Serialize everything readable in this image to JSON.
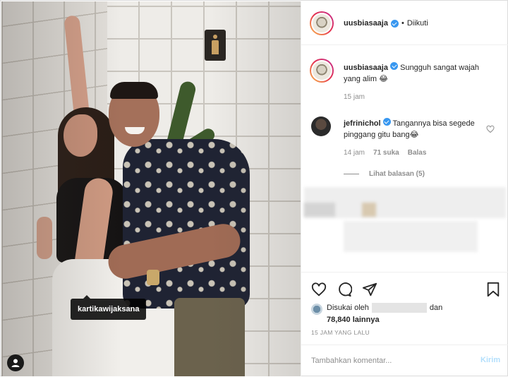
{
  "post": {
    "tagged_user": "kartikawijaksana"
  },
  "header": {
    "username": "uusbiasaaja",
    "separator": "•",
    "follow_status": "Diikuti"
  },
  "caption": {
    "username": "uusbiasaaja",
    "text": "Sungguh sangat wajah yang alim 😂",
    "time": "15 jam"
  },
  "comment": {
    "username": "jefrinichol",
    "text": "Tangannya bisa segede pinggang gitu bang😂",
    "time": "14 jam",
    "likes": "71 suka",
    "reply_label": "Balas",
    "view_replies": "Lihat balasan (5)"
  },
  "likes": {
    "prefix": "Disukai oleh",
    "conjunction": "dan",
    "count": "78,840 lainnya"
  },
  "timestamp": "15 JAM YANG LALU",
  "comment_box": {
    "placeholder": "Tambahkan komentar...",
    "post_label": "Kirim"
  },
  "icons": {
    "like": "heart-icon",
    "comment": "comment-icon",
    "share": "share-icon",
    "save": "bookmark-icon",
    "verified": "verified-badge-icon",
    "tag": "user-tag-icon"
  },
  "colors": {
    "verified": "#3897f0",
    "muted": "#8e8e8e",
    "post_button": "#b2dffc"
  }
}
